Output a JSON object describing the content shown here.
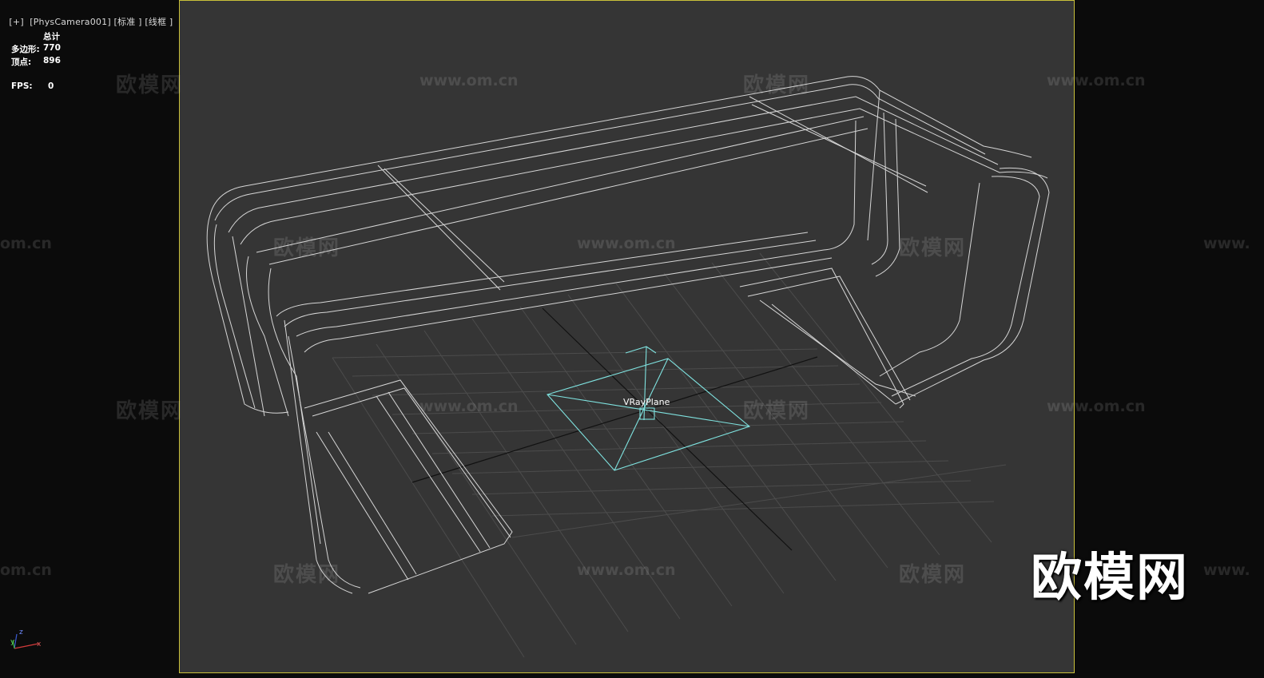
{
  "viewport": {
    "menu_button": "[+]",
    "camera": "[PhysCamera001]",
    "shading": "[标准 ]",
    "display": "[线框 ]"
  },
  "stats": {
    "header": "总计",
    "polygons_label": "多边形:",
    "polygons_value": "770",
    "vertices_label": "顶点:",
    "vertices_value": "896",
    "fps_label": "FPS:",
    "fps_value": "0"
  },
  "scene": {
    "object_label": "VRayPlane"
  },
  "watermark": {
    "brand_cn": "欧模网",
    "url": "www.om.cn",
    "url_partial_left": "om.cn",
    "url_partial_right": "www."
  },
  "axis_gizmo": {
    "x": "x",
    "y": "y",
    "z": "z"
  },
  "colors": {
    "viewport_bg": "#353535",
    "side_bg": "#0b0b0b",
    "active_border": "#c9c03a",
    "wire": "#e6e6e6",
    "light_cyan": "#7fe3e0",
    "grid": "#4a4a4a"
  }
}
